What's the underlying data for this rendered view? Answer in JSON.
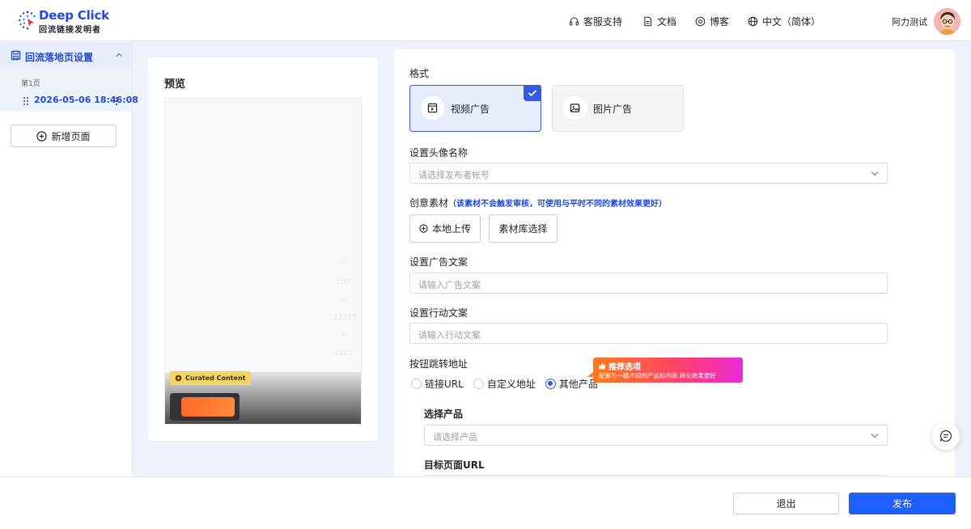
{
  "header": {
    "logo_title": "Deep Click",
    "logo_subtitle": "回流链接发明者",
    "nav": [
      {
        "label": "客服支持",
        "icon": "headset-icon"
      },
      {
        "label": "文档",
        "icon": "document-icon"
      },
      {
        "label": "博客",
        "icon": "blog-icon"
      },
      {
        "label": "中文（简体）",
        "icon": "globe-icon"
      }
    ],
    "user_name": "阿力测试"
  },
  "sidebar": {
    "section_title": "回流落地页设置",
    "page_label": "第1页",
    "page_item": "2026-05-06 18:46:08",
    "add_page": "新增页面"
  },
  "preview": {
    "title": "预览",
    "curated_tag": "Curated Content",
    "side_ghosts": [
      "♡",
      "190",
      "☆",
      "12333",
      "↗",
      "4321"
    ]
  },
  "form": {
    "format_label": "格式",
    "formats": [
      {
        "label": "视频广告",
        "selected": true,
        "icon": "video-ad-icon"
      },
      {
        "label": "图片广告",
        "selected": false,
        "icon": "image-ad-icon"
      }
    ],
    "avatar_label": "设置头像名称",
    "avatar_placeholder": "请选择发布者帐号",
    "material_label": "创意素材",
    "material_hint": "（该素材不会触发审核，可使用与平时不同的素材效果更好）",
    "upload_local": "本地上传",
    "upload_library": "素材库选择",
    "ad_copy_label": "设置广告文案",
    "ad_copy_placeholder": "请输入广告文案",
    "action_copy_label": "设置行动文案",
    "action_copy_placeholder": "请输入行动文案",
    "redirect_label": "按钮跳转地址",
    "redirect_options": [
      {
        "label": "链接URL",
        "selected": false
      },
      {
        "label": "自定义地址",
        "selected": false
      },
      {
        "label": "其他产品",
        "selected": true
      }
    ],
    "recommend_title": "推荐选项",
    "recommend_desc": "配置与一跳不同的产品和内容,转化效果更好",
    "product_label": "选择产品",
    "product_placeholder": "请选择产品",
    "target_url_label": "目标页面URL"
  },
  "footer": {
    "exit": "退出",
    "publish": "发布"
  },
  "colors": {
    "primary": "#1f5fff",
    "brand_blue": "#1f49e0",
    "selected_bg": "#e8edfc"
  }
}
